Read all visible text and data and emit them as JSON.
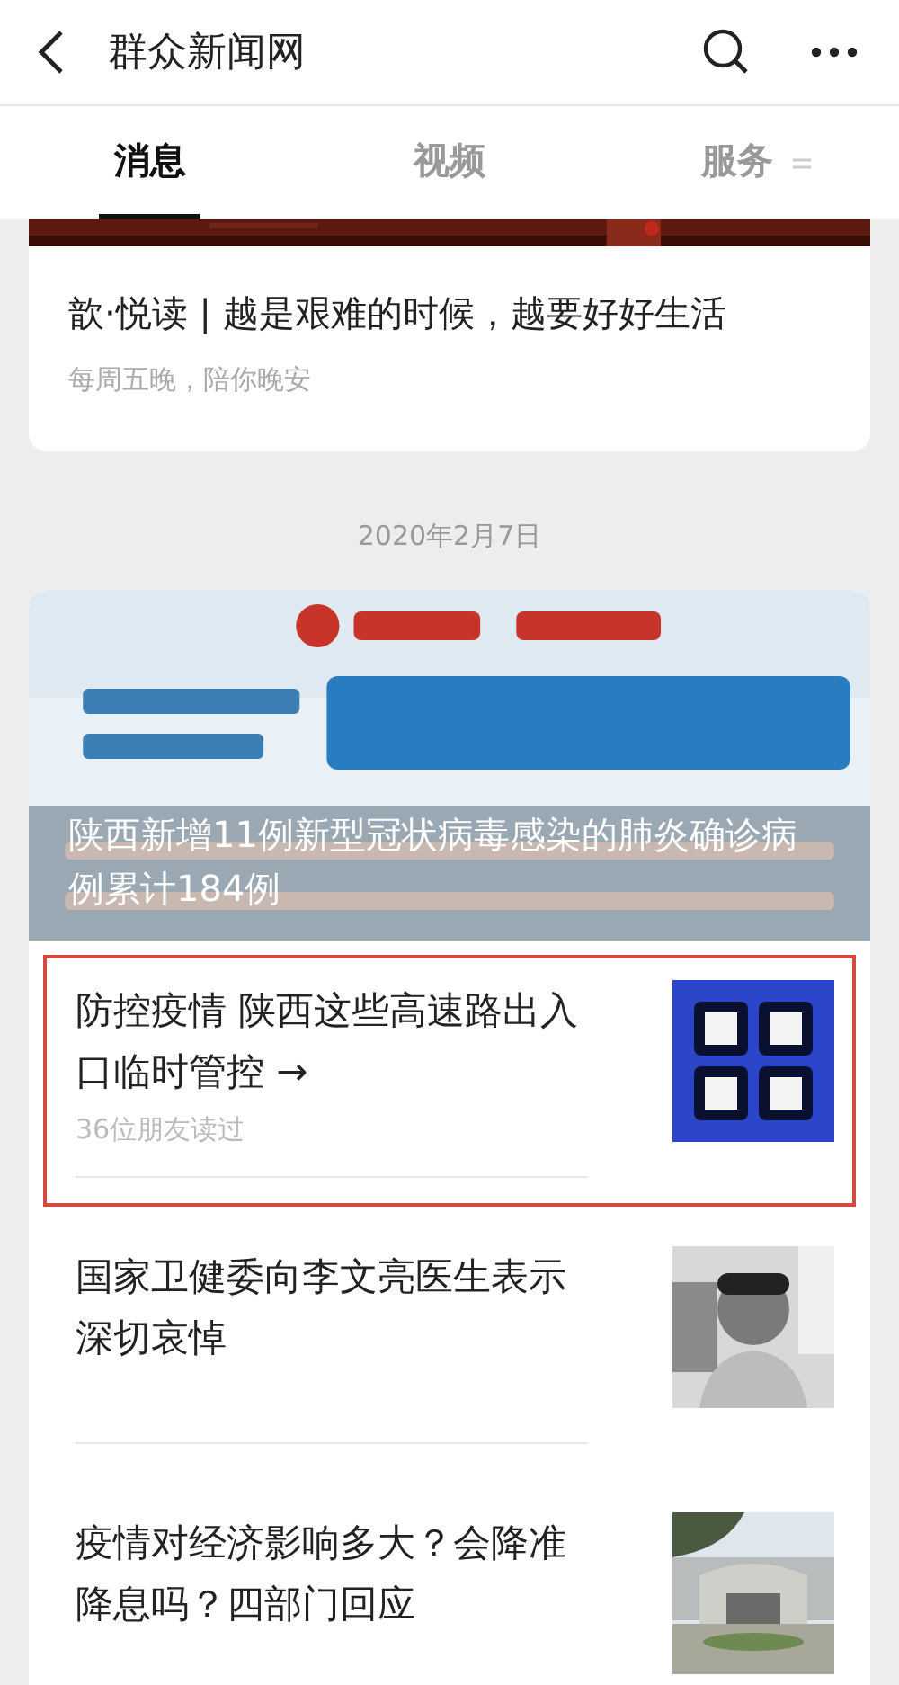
{
  "header": {
    "title": "群众新闻网"
  },
  "tabs": [
    {
      "label": "消息",
      "selected": true
    },
    {
      "label": "视频",
      "selected": false
    },
    {
      "label": "服务",
      "selected": false,
      "menu": true
    }
  ],
  "top_card": {
    "title": "歆·悦读 | 越是艰难的时候，越要好好生活",
    "subtitle": "每周五晚，陪你晚安"
  },
  "date": "2020年2月7日",
  "article_group": {
    "lead": {
      "headline": "陕西新增11例新型冠状病毒感染的肺炎确诊病例累计184例"
    },
    "items": [
      {
        "title": "防控疫情 陕西这些高速路出入口临时管控 →",
        "meta": "36位朋友读过",
        "highlighted": true
      },
      {
        "title": "国家卫健委向李文亮医生表示深切哀悼",
        "highlighted": false
      },
      {
        "title": "疫情对经济影响多大？会降准降息吗？四部门回应",
        "highlighted": false
      }
    ]
  }
}
